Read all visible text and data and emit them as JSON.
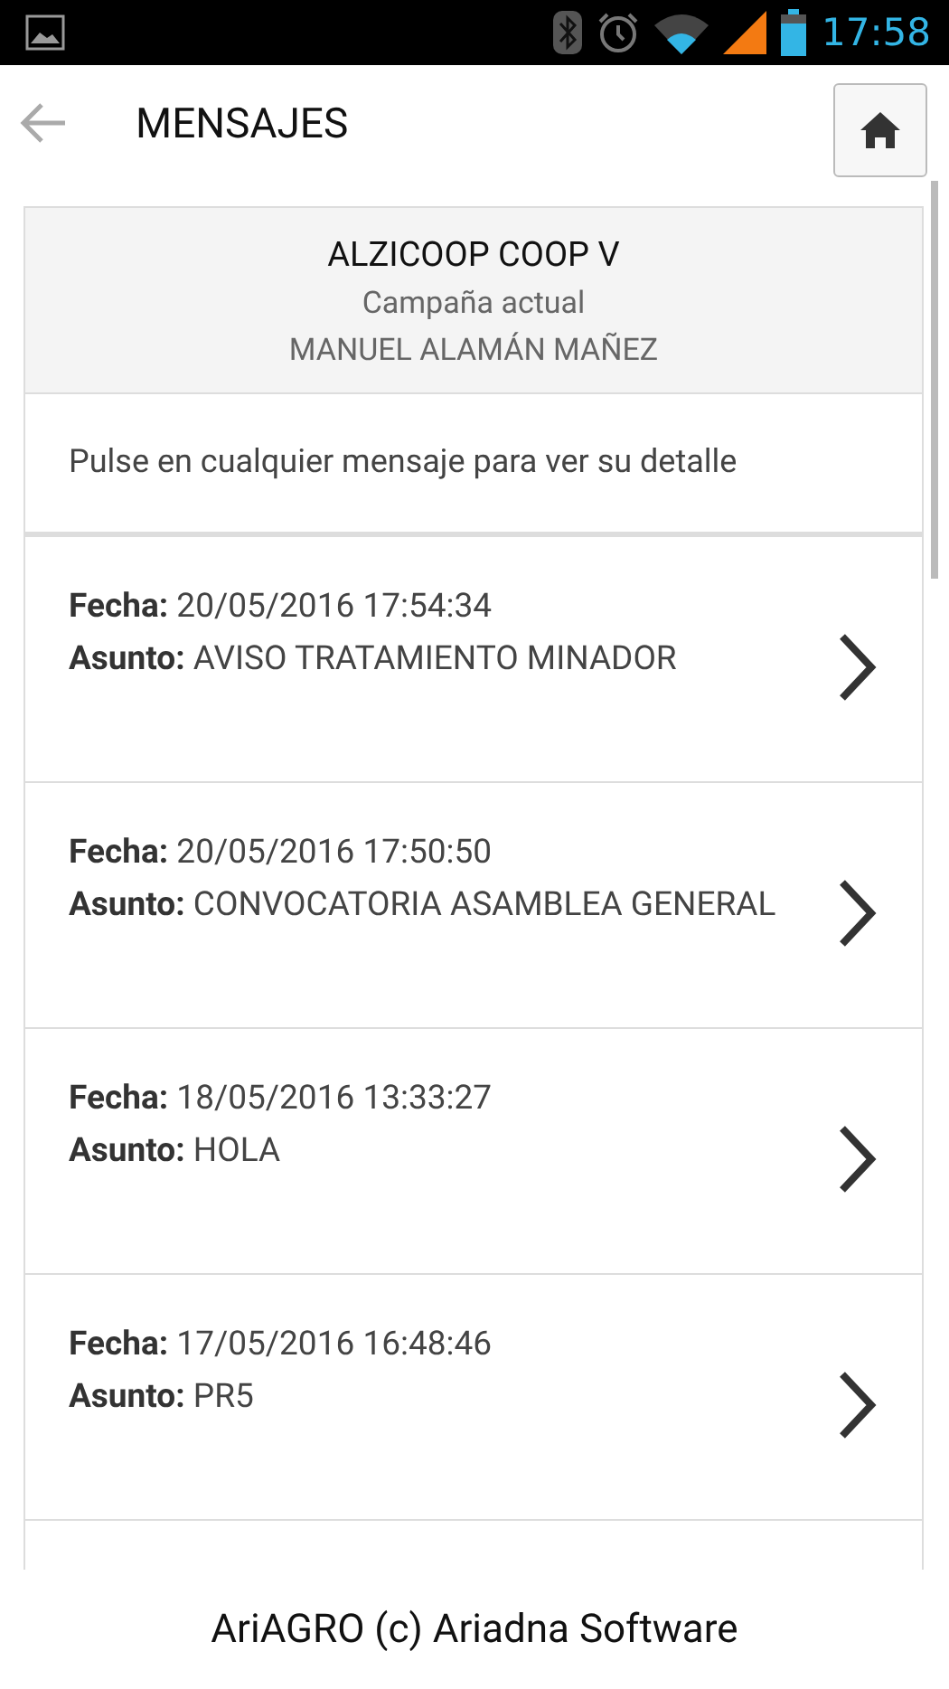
{
  "status_bar": {
    "time": "17:58"
  },
  "header": {
    "title": "MENSAJES"
  },
  "account": {
    "company": "ALZICOOP COOP V",
    "campaign": "Campaña actual",
    "member": "MANUEL ALAMÁN MAÑEZ"
  },
  "hint": "Pulse en cualquier mensaje para ver su detalle",
  "messages": [
    {
      "date": "**Fecha:** 20/05/2016 17:54:34",
      "subject": "**Asunto:** AVISO TRATAMIENTO MINADOR"
    },
    {
      "date": "**Fecha:** 20/05/2016 17:50:50",
      "subject": "**Asunto:** CONVOCATORIA ASAMBLEA GENERAL"
    },
    {
      "date": "**Fecha:** 18/05/2016 13:33:27",
      "subject": "**Asunto:** HOLA"
    },
    {
      "date": "**Fecha:** 17/05/2016 16:48:46",
      "subject": "**Asunto:** PR5"
    }
  ],
  "footer": "AriAGRO (c) Ariadna Software"
}
